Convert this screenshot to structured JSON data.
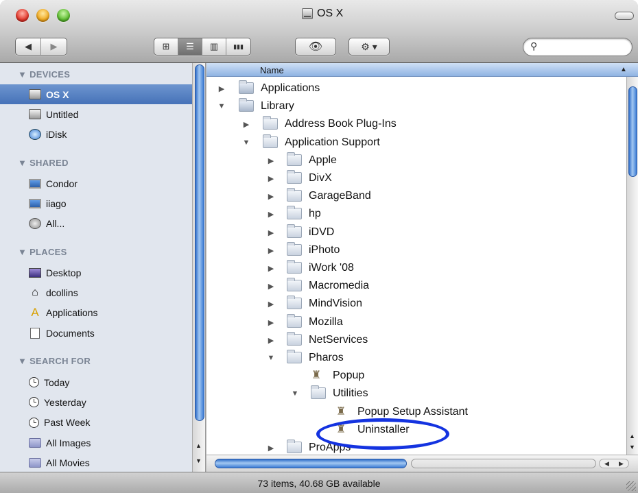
{
  "window": {
    "title": "OS X"
  },
  "toolbar": {
    "back_icon": "◀",
    "forward_icon": "▶",
    "view_icons": [
      "⊞",
      "☰",
      "▥",
      "▮▮▮"
    ],
    "quicklook_icon": "👁",
    "action_icon": "⚙ ▾",
    "search_icon": "⚲",
    "search_placeholder": ""
  },
  "sidebar": {
    "sections": [
      {
        "title": "▼ DEVICES",
        "items": [
          {
            "label": "OS X",
            "icon": "hard-drive-icon",
            "selected": true
          },
          {
            "label": "Untitled",
            "icon": "hard-drive-icon"
          },
          {
            "label": "iDisk",
            "icon": "idisk-icon"
          }
        ]
      },
      {
        "title": "▼ SHARED",
        "items": [
          {
            "label": "Condor",
            "icon": "computer-icon"
          },
          {
            "label": "iiago",
            "icon": "computer-icon"
          },
          {
            "label": "All...",
            "icon": "network-icon"
          }
        ]
      },
      {
        "title": "▼ PLACES",
        "items": [
          {
            "label": "Desktop",
            "icon": "desktop-icon"
          },
          {
            "label": "dcollins",
            "icon": "home-icon"
          },
          {
            "label": "Applications",
            "icon": "applications-icon"
          },
          {
            "label": "Documents",
            "icon": "document-icon"
          }
        ]
      },
      {
        "title": "▼ SEARCH FOR",
        "items": [
          {
            "label": "Today",
            "icon": "clock-icon"
          },
          {
            "label": "Yesterday",
            "icon": "clock-icon"
          },
          {
            "label": "Past Week",
            "icon": "clock-icon"
          },
          {
            "label": "All Images",
            "icon": "smart-folder-icon"
          },
          {
            "label": "All Movies",
            "icon": "smart-folder-icon"
          }
        ]
      }
    ]
  },
  "list": {
    "column_name": "Name",
    "sort_arrow": "▲",
    "rows": [
      {
        "label": "Applications",
        "level": 0,
        "expander": "▶",
        "icon": "system-folder"
      },
      {
        "label": "Library",
        "level": 0,
        "expander": "▼",
        "icon": "system-folder"
      },
      {
        "label": "Address Book Plug-Ins",
        "level": 1,
        "expander": "▶",
        "icon": "folder"
      },
      {
        "label": "Application Support",
        "level": 1,
        "expander": "▼",
        "icon": "folder"
      },
      {
        "label": "Apple",
        "level": 2,
        "expander": "▶",
        "icon": "folder"
      },
      {
        "label": "DivX",
        "level": 2,
        "expander": "▶",
        "icon": "folder"
      },
      {
        "label": "GarageBand",
        "level": 2,
        "expander": "▶",
        "icon": "folder"
      },
      {
        "label": "hp",
        "level": 2,
        "expander": "▶",
        "icon": "folder"
      },
      {
        "label": "iDVD",
        "level": 2,
        "expander": "▶",
        "icon": "folder"
      },
      {
        "label": "iPhoto",
        "level": 2,
        "expander": "▶",
        "icon": "folder"
      },
      {
        "label": "iWork '08",
        "level": 2,
        "expander": "▶",
        "icon": "folder"
      },
      {
        "label": "Macromedia",
        "level": 2,
        "expander": "▶",
        "icon": "folder"
      },
      {
        "label": "MindVision",
        "level": 2,
        "expander": "▶",
        "icon": "folder"
      },
      {
        "label": "Mozilla",
        "level": 2,
        "expander": "▶",
        "icon": "folder"
      },
      {
        "label": "NetServices",
        "level": 2,
        "expander": "▶",
        "icon": "folder"
      },
      {
        "label": "Pharos",
        "level": 2,
        "expander": "▼",
        "icon": "folder"
      },
      {
        "label": "Popup",
        "level": 3,
        "expander": "",
        "icon": "executable"
      },
      {
        "label": "Utilities",
        "level": 3,
        "expander": "▼",
        "icon": "folder"
      },
      {
        "label": "Popup Setup Assistant",
        "level": 4,
        "expander": "",
        "icon": "executable"
      },
      {
        "label": "Uninstaller",
        "level": 4,
        "expander": "",
        "icon": "executable"
      },
      {
        "label": "ProApps",
        "level": 2,
        "expander": "▶",
        "icon": "folder"
      }
    ]
  },
  "status": {
    "text": "73 items, 40.68 GB available"
  },
  "colors": {
    "annotation": "#1433e0",
    "selection": "#4672b8"
  }
}
